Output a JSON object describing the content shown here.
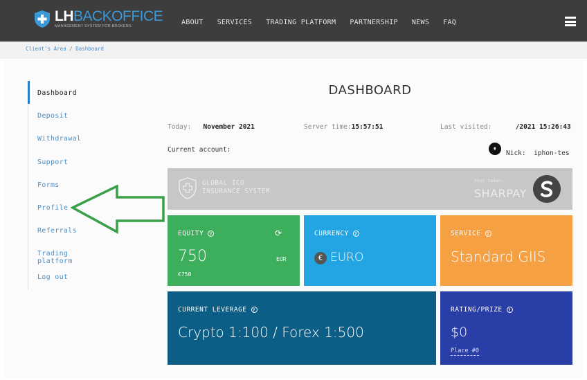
{
  "header": {
    "logo_lh": "LH",
    "logo_backoffice": "BACKOFFICE",
    "logo_subtitle": "MANAGEMENT SYSTEM FOR BROKERS",
    "nav": [
      "ABOUT",
      "SERVICES",
      "TRADING PLATFORM",
      "PARTNERSHIP",
      "NEWS",
      "FAQ"
    ],
    "menu_icon": "hamburger-icon"
  },
  "breadcrumb": {
    "home": "Client's Area",
    "separator": "/",
    "current": "Dashboard"
  },
  "sidebar": {
    "items": [
      {
        "label": "Dashboard",
        "active": true
      },
      {
        "label": "Deposit"
      },
      {
        "label": "Withdrawal"
      },
      {
        "label": "Support"
      },
      {
        "label": "Forms"
      },
      {
        "label": "Profile"
      },
      {
        "label": "Referrals"
      },
      {
        "label": "Trading platform"
      },
      {
        "label": "Log out"
      }
    ]
  },
  "page": {
    "title": "DASHBOARD",
    "today_label": "Today:",
    "today_value": "November 2021",
    "server_label": "Server time:",
    "server_value": "15:57:51",
    "last_label": "Last visited:",
    "last_value": "/2021 15:26:43",
    "account_label": "Current account:",
    "nick_label": "Nick:",
    "nick_value": "iphon-tes"
  },
  "banner": {
    "line1": "GLOBAL ICO",
    "line2": "INSURANCE SYSTEM",
    "token_label": "Your token:",
    "token_value": "SHARPAY"
  },
  "cards": {
    "equity": {
      "title": "EQUITY",
      "value": "750",
      "currency": "EUR",
      "sub": "€750"
    },
    "currency": {
      "title": "CURRENCY",
      "value": "EURO"
    },
    "service": {
      "title": "SERVICE",
      "value": "Standard GIIS"
    },
    "leverage": {
      "title": "CURRENT LEVERAGE",
      "value": "Crypto 1:100 / Forex 1:500"
    },
    "rating": {
      "title": "RATING/PRIZE",
      "value": "$0",
      "place": "Place #0"
    }
  },
  "colors": {
    "topbar": "#3d3d3d",
    "accent_blue": "#3a9ad9",
    "arrow_green": "#3aa047",
    "equity": "#3dae5b",
    "currency": "#22a5e2",
    "service": "#f5a043",
    "leverage": "#0d5e86",
    "rating": "#2a3ea7"
  }
}
